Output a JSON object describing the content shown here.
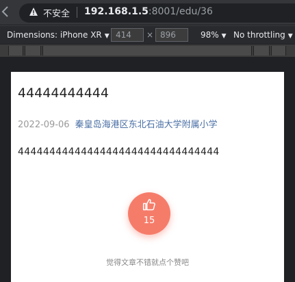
{
  "browser": {
    "security_label": "不安全",
    "url_host": "192.168.1.5",
    "url_rest": ":8001/edu/36"
  },
  "device_toolbar": {
    "dimensions_label": "Dimensions: iPhone XR",
    "width": "414",
    "height": "896",
    "times": "×",
    "zoom": "98%",
    "throttling": "No throttling"
  },
  "article": {
    "title": "44444444444",
    "date": "2022-09-06",
    "school": "秦皇岛海港区东北石油大学附属小学",
    "content": "44444444444444444444444444444444",
    "like_count": "15",
    "like_hint": "觉得文章不错就点个赞吧"
  },
  "colors": {
    "like_button": "#f67c6a",
    "school_link": "#4a6fa5"
  }
}
